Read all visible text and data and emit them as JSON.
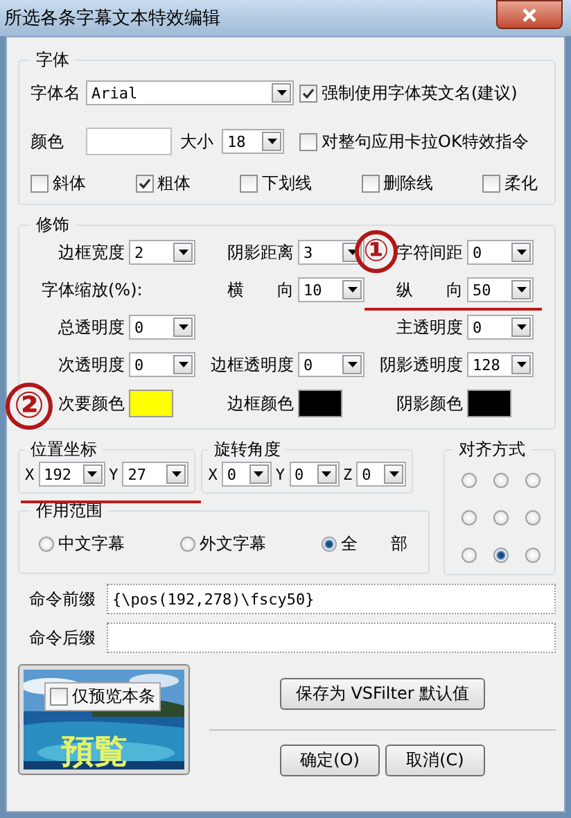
{
  "window": {
    "title": "所选各条字幕文本特效编辑"
  },
  "font_group": {
    "title": "字体",
    "font_name": {
      "label": "字体名",
      "value": "Arial"
    },
    "force_english": {
      "label": "强制使用字体英文名(建议)",
      "checked": true
    },
    "color": {
      "label": "颜色",
      "color": "#ffffff"
    },
    "size": {
      "label": "大小",
      "value": "18"
    },
    "karaoke": {
      "label": "对整句应用卡拉OK特效指令",
      "checked": false
    },
    "styles": [
      {
        "label": "斜体",
        "checked": false
      },
      {
        "label": "粗体",
        "checked": true
      },
      {
        "label": "下划线",
        "checked": false
      },
      {
        "label": "删除线",
        "checked": false
      },
      {
        "label": "柔化",
        "checked": false
      }
    ]
  },
  "decoration_group": {
    "title": "修饰",
    "rows": [
      [
        {
          "kind": "dropdown",
          "label": "边框宽度",
          "value": "2"
        },
        {
          "kind": "dropdown",
          "label": "阴影距离",
          "value": "3"
        },
        {
          "kind": "dropdown",
          "label": "字符间距",
          "value": "0"
        }
      ],
      [
        {
          "kind": "text",
          "label": "字体缩放(%):"
        },
        {
          "kind": "dropdown",
          "label": "横　　向",
          "value": "10"
        },
        {
          "kind": "dropdown",
          "label": "纵　　向",
          "value": "50"
        }
      ],
      [
        {
          "kind": "dropdown",
          "label": "总透明度",
          "value": "0"
        },
        "",
        {
          "kind": "dropdown",
          "label": "主透明度",
          "value": "0"
        }
      ],
      [
        {
          "kind": "dropdown",
          "label": "次透明度",
          "value": "0"
        },
        {
          "kind": "dropdown",
          "label": "边框透明度",
          "value": "0"
        },
        {
          "kind": "dropdown",
          "label": "阴影透明度",
          "value": "128"
        }
      ],
      [
        {
          "kind": "color",
          "label": "次要颜色",
          "color": "#ffff00"
        },
        {
          "kind": "color",
          "label": "边框颜色",
          "color": "#000000"
        },
        {
          "kind": "color",
          "label": "阴影颜色",
          "color": "#000000"
        }
      ]
    ]
  },
  "position_group": {
    "title": "位置坐标",
    "fields": [
      {
        "label": "X",
        "value": "192"
      },
      {
        "label": "Y",
        "value": "27"
      }
    ]
  },
  "rotation_group": {
    "title": "旋转角度",
    "fields": [
      {
        "label": "X",
        "value": "0"
      },
      {
        "label": "Y",
        "value": "0"
      },
      {
        "label": "Z",
        "value": "0"
      }
    ]
  },
  "scope_group": {
    "title": "作用范围",
    "options": [
      {
        "label": "中文字幕",
        "selected": false
      },
      {
        "label": "外文字幕",
        "selected": false
      },
      {
        "label": "全　　部",
        "selected": true
      }
    ]
  },
  "alignment_group": {
    "title": "对齐方式",
    "options": [
      {
        "selected": false
      },
      {
        "selected": false
      },
      {
        "selected": false
      },
      {
        "selected": false
      },
      {
        "selected": false
      },
      {
        "selected": false
      },
      {
        "selected": false
      },
      {
        "selected": true
      },
      {
        "selected": false
      }
    ]
  },
  "command_prefix": {
    "label": "命令前缀",
    "value": "{\\pos(192,278)\\fscy50}"
  },
  "command_suffix": {
    "label": "命令后缀"
  },
  "preview": {
    "checkbox": {
      "label": "仅预览本条",
      "checked": false
    },
    "caption": "預覧"
  },
  "buttons": {
    "save_default": "保存为 VSFilter 默认值",
    "ok": "确定(O)",
    "cancel": "取消(C)"
  },
  "annotations": [
    {
      "label": "①"
    },
    {
      "label": "②"
    }
  ]
}
